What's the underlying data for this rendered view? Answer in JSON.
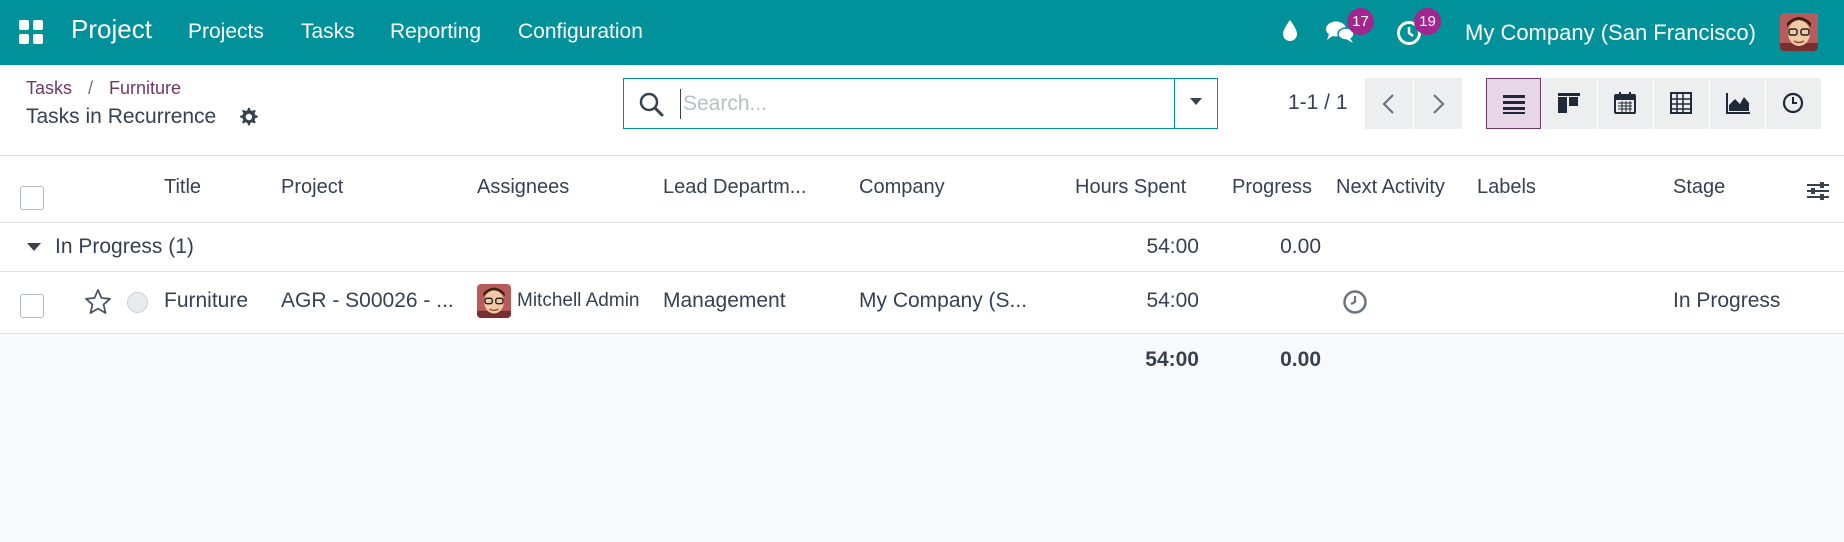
{
  "navbar": {
    "app_name": "Project",
    "menu": [
      "Projects",
      "Tasks",
      "Reporting",
      "Configuration"
    ],
    "messages_count": "17",
    "activities_count": "19",
    "company": "My Company (San Francisco)",
    "bg_color": "#00919a",
    "badge_color": "#a2268f"
  },
  "breadcrumb": {
    "items": [
      "Tasks",
      "Furniture"
    ],
    "separator": "/",
    "current": "Tasks in Recurrence"
  },
  "search": {
    "placeholder": "Search...",
    "value": ""
  },
  "pager": {
    "value": "1-1 / 1"
  },
  "views": {
    "items": [
      "list",
      "kanban",
      "calendar",
      "pivot",
      "graph",
      "activity"
    ],
    "active": "list"
  },
  "table": {
    "columns": [
      "Title",
      "Project",
      "Assignees",
      "Lead Departm...",
      "Company",
      "Hours Spent",
      "Progress",
      "Next Activity",
      "Labels",
      "Stage"
    ],
    "group": {
      "label": "In Progress (1)",
      "hours_spent": "54:00",
      "progress": "0.00"
    },
    "rows": [
      {
        "title": "Furniture",
        "project": "AGR - S00026 - ...",
        "assignee": "Mitchell Admin",
        "lead_department": "Management",
        "company": "My Company (S...",
        "hours_spent": "54:00",
        "progress": "",
        "labels": "",
        "stage": "In Progress"
      }
    ],
    "totals": {
      "hours_spent": "54:00",
      "progress": "0.00"
    }
  },
  "colors": {
    "accent": "#71376b",
    "active_view_bg": "#e7d6e5"
  }
}
